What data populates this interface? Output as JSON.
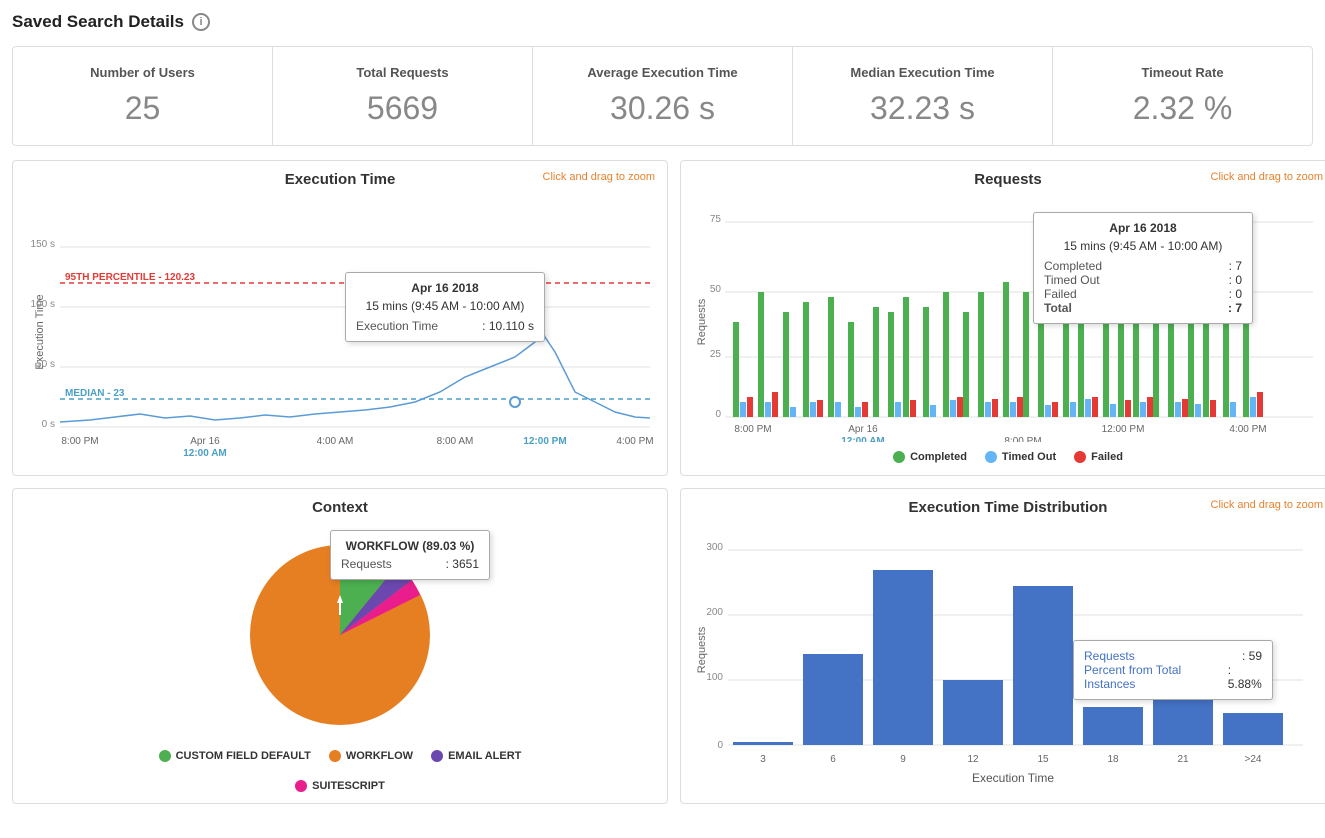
{
  "header": {
    "title": "Saved Search Details",
    "info_icon": "i"
  },
  "kpis": [
    {
      "label": "Number of Users",
      "value": "25"
    },
    {
      "label": "Total Requests",
      "value": "5669"
    },
    {
      "label": "Average Execution Time",
      "value": "30.26 s"
    },
    {
      "label": "Median Execution Time",
      "value": "32.23 s"
    },
    {
      "label": "Timeout Rate",
      "value": "2.32 %"
    }
  ],
  "charts": {
    "execution_time": {
      "title": "Execution Time",
      "hint": "Click and drag to zoom",
      "y_label": "Execution Time",
      "percentile_label": "95TH PERCENTILE - 120.23",
      "median_label": "MEDIAN - 23",
      "tooltip": {
        "date": "Apr 16 2018",
        "period": "15 mins (9:45 AM - 10:00 AM)",
        "field": "Execution Time",
        "value": "10.110 s"
      }
    },
    "requests": {
      "title": "Requests",
      "hint": "Click and drag to zoom",
      "y_label": "Requests",
      "tooltip": {
        "date": "Apr 16 2018",
        "period": "15 mins (9:45 AM - 10:00 AM)",
        "rows": [
          {
            "label": "Completed",
            "value": "7"
          },
          {
            "label": "Timed Out",
            "value": "0"
          },
          {
            "label": "Failed",
            "value": "0"
          },
          {
            "label": "Total",
            "value": "7"
          }
        ]
      },
      "legend": [
        {
          "label": "Completed",
          "color": "#4caf50"
        },
        {
          "label": "Timed Out",
          "color": "#64b5f6"
        },
        {
          "label": "Failed",
          "color": "#e53935"
        }
      ]
    },
    "context": {
      "title": "Context",
      "tooltip": {
        "label": "WORKFLOW (89.03 %)",
        "field": "Requests",
        "value": "3651"
      },
      "legend": [
        {
          "label": "CUSTOM FIELD DEFAULT",
          "color": "#4caf50"
        },
        {
          "label": "WORKFLOW",
          "color": "#e67e22"
        },
        {
          "label": "EMAIL ALERT",
          "color": "#6b48b0"
        },
        {
          "label": "SUITESCRIPT",
          "color": "#e91e8c"
        }
      ]
    },
    "distribution": {
      "title": "Execution Time Distribution",
      "hint": "Click and drag to zoom",
      "x_label": "Execution Time",
      "y_label": "Requests",
      "tooltip": {
        "requests": "59",
        "percent": "5.88%"
      },
      "bars": [
        {
          "x_label": "3",
          "value": 5,
          "max": 300
        },
        {
          "x_label": "6",
          "value": 140,
          "max": 300
        },
        {
          "x_label": "9",
          "value": 270,
          "max": 300
        },
        {
          "x_label": "12",
          "value": 100,
          "max": 300
        },
        {
          "x_label": "15",
          "value": 245,
          "max": 300
        },
        {
          "x_label": "18",
          "value": 59,
          "max": 300
        },
        {
          "x_label": "21",
          "value": 80,
          "max": 300
        },
        {
          "x_label": ">24",
          "value": 50,
          "max": 300
        }
      ]
    }
  }
}
